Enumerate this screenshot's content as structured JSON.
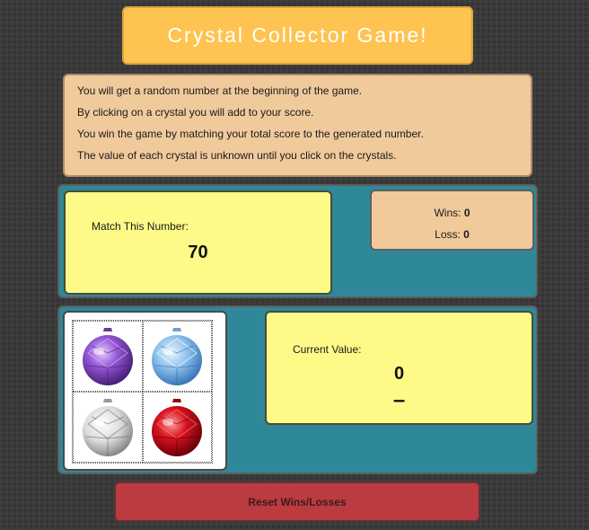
{
  "title": "Crystal Collector Game!",
  "instructions": [
    "You will get a random number at the beginning of the game.",
    "By clicking on a crystal you will add to your score.",
    "You win the game by matching your total score to the generated number.",
    "The value of each crystal is unknown until you click on the crystals."
  ],
  "match": {
    "label": "Match This Number:",
    "value": "70"
  },
  "score": {
    "wins_label": "Wins:",
    "wins": "0",
    "loss_label": "Loss:",
    "loss": "0"
  },
  "crystals": [
    {
      "name": "purple",
      "color": "#8b4fc6"
    },
    {
      "name": "blue",
      "color": "#7fb5e6"
    },
    {
      "name": "clear",
      "color": "#e8e8e8"
    },
    {
      "name": "red",
      "color": "#c8101c"
    }
  ],
  "current": {
    "label": "Current Value:",
    "value": "0",
    "dash": "–"
  },
  "reset_label": "Reset Wins/Losses"
}
